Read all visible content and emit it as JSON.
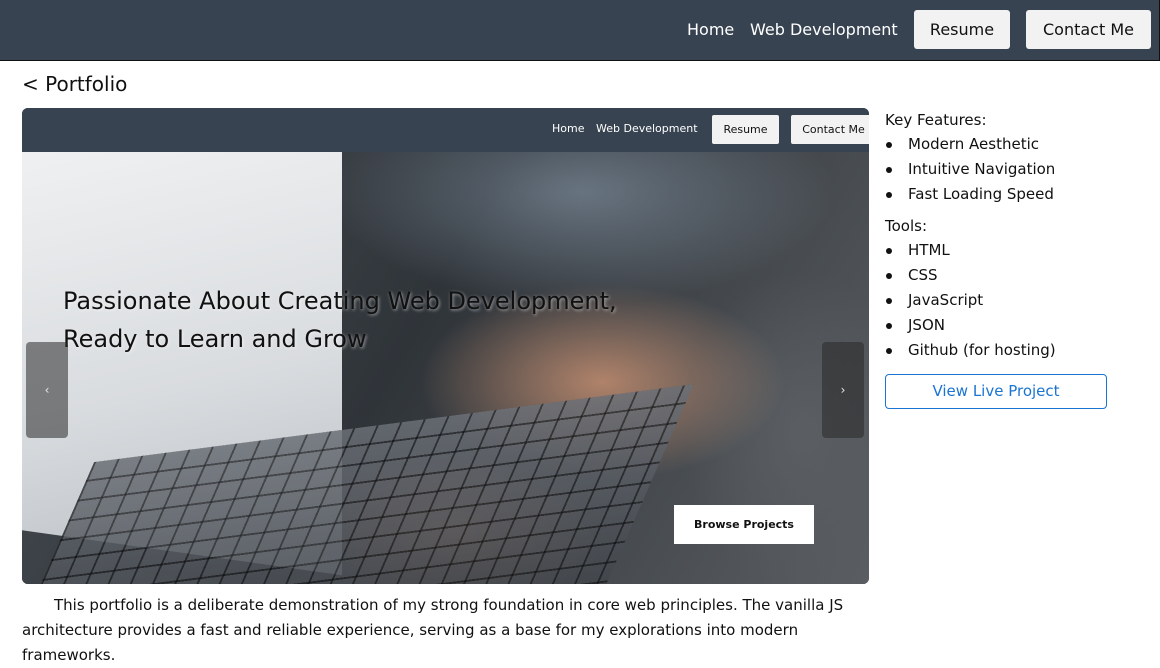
{
  "nav": {
    "links": [
      "Home",
      "Web Development"
    ],
    "buttons": [
      "Resume",
      "Contact Me"
    ]
  },
  "back_link": "< Portfolio",
  "preview": {
    "nav_links": [
      "Home",
      "Web Development"
    ],
    "nav_buttons": [
      "Resume",
      "Contact Me"
    ],
    "hero_title_line1": "Passionate About Creating Web Development,",
    "hero_title_line2": "Ready to Learn and Grow",
    "browse_button": "Browse Projects",
    "carousel_prev": "‹",
    "carousel_next": "›"
  },
  "side": {
    "features_heading": "Key Features:",
    "features": [
      "Modern Aesthetic",
      "Intuitive Navigation",
      "Fast Loading Speed"
    ],
    "tools_heading": "Tools:",
    "tools": [
      "HTML",
      "CSS",
      "JavaScript",
      "JSON",
      "Github (for hosting)"
    ],
    "live_button": "View Live Project"
  },
  "description": "This portfolio is a deliberate demonstration of my strong foundation in core web principles. The vanilla JS architecture provides a fast and reliable experience, serving as a base for my explorations into modern frameworks.",
  "colors": {
    "navbar": "#374351",
    "accent": "#1a74d1",
    "button_bg": "#f2f2f2"
  }
}
